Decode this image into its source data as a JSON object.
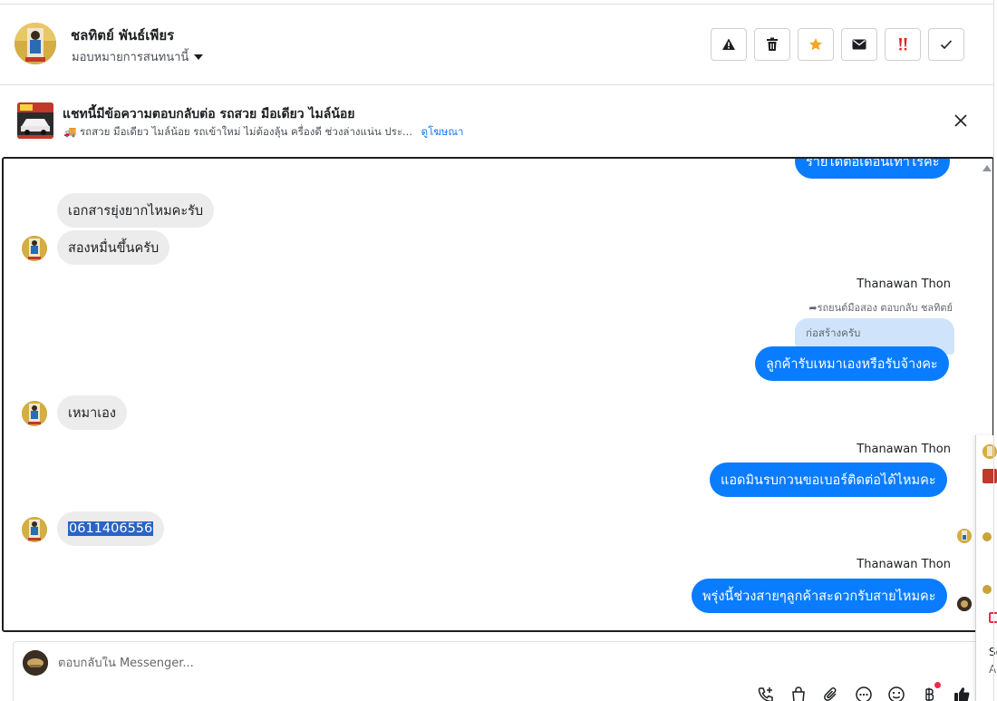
{
  "header": {
    "contact_name": "ชลทิตย์ พันธ์เพียร",
    "assign_label": "มอบหมายการสนทนานี้",
    "actions": [
      "warning-icon",
      "trash-icon",
      "star-icon",
      "mail-icon",
      "spam-icon",
      "check-icon"
    ]
  },
  "ad": {
    "title": "แชทนี้มีข้อความตอบกลับต่อ รถสวย มือเดียว ไมล์น้อย",
    "subtitle": "🚚 รถสวย มือเดียว ไมล์น้อย รถเข้าใหม่ ไม่ต้องลุ้น ครื่องดี ช่วงล่างแน่น ประ...",
    "link": "ดูโฆษณา"
  },
  "messages": {
    "partial_top": "รายได้ต่อเดือนเท่าไรคะ",
    "m1": "เอกสารยุ่งยากไหมคะรับ",
    "m2": "สองหมื่นขึ้นครับ",
    "sender1": "Thanawan Thon",
    "reply_note": "รถยนต์มือสอง ตอบกลับ ชลทิตย์",
    "quoted": "ก่อสร้างครับ",
    "m3": "ลูกค้ารับเหมาเองหรือรับจ้างคะ",
    "m4": "เหมาเอง",
    "sender2": "Thanawan Thon",
    "m5": "แอดมินรบกวนขอเบอร์ติดต่อได้ไหมคะ",
    "m6": "0611406556",
    "sender3": "Thanawan Thon",
    "m7": "พรุ่งนี้ช่วงสายๆลูกค้าสะดวกรับสายไหมคะ"
  },
  "composer": {
    "placeholder": "ตอบกลับใน Messenger...",
    "tools": [
      "call-add-icon",
      "shopping-bag-icon",
      "paperclip-icon",
      "ellipsis-bubble-icon",
      "emoji-icon",
      "baht-icon",
      "thumbs-up-icon"
    ]
  },
  "sliver": {
    "text1": "Se",
    "text2": "A"
  },
  "colors": {
    "outgoing": "#0a7cff",
    "incoming": "#ececec",
    "selection": "#2a63c7",
    "star": "#f5a623",
    "spam": "#e02020"
  }
}
